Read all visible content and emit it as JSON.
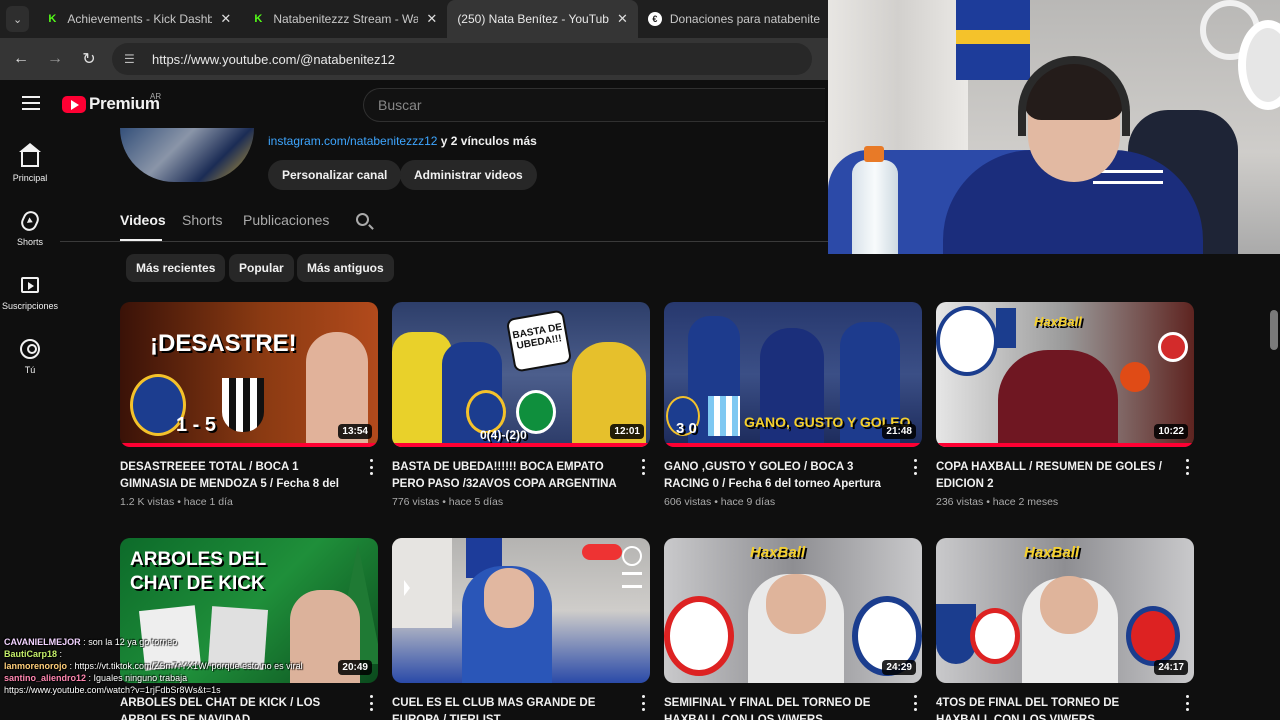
{
  "browser": {
    "tabs": [
      {
        "title": "Achievements - Kick Dashbo",
        "icon": "kick-icon",
        "active": false
      },
      {
        "title": "Natabenitezzz Stream - Wat",
        "icon": "kick-icon",
        "active": false
      },
      {
        "title": "(250) Nata Benítez - YouTub",
        "icon": "youtube-icon",
        "active": true
      },
      {
        "title": "Donaciones para natabenite",
        "icon": "donation-icon",
        "active": false
      }
    ],
    "url": "https://www.youtube.com/@natabenitez12"
  },
  "youtube": {
    "logo_word": "Premium",
    "country": "AR",
    "search_placeholder": "Buscar",
    "sidebar": [
      {
        "label": "Principal",
        "icon": "home-icon"
      },
      {
        "label": "Shorts",
        "icon": "shorts-icon"
      },
      {
        "label": "Suscripciones",
        "icon": "subscriptions-icon"
      },
      {
        "label": "Tú",
        "icon": "you-icon"
      }
    ],
    "channel": {
      "link": "instagram.com/natabenitezzz12",
      "more_links": "y 2 vínculos más",
      "customize_button": "Personalizar canal",
      "manage_button": "Administrar videos"
    },
    "tabs": [
      "Videos",
      "Shorts",
      "Publicaciones"
    ],
    "filters": [
      "Más recientes",
      "Popular",
      "Más antiguos"
    ],
    "videos": [
      {
        "title": "DESASTREEEE TOTAL / BOCA 1 GIMNASIA DE MENDOZA 5 / Fecha 8 del torneo...",
        "views": "1.2 K vistas",
        "age": "hace 1 día",
        "duration": "13:54",
        "thumb_text": "¡DESASTRE!",
        "thumb_score": "1 - 5"
      },
      {
        "title": "BASTA DE UBEDA!!!!!! BOCA EMPATO PERO PASO /32AVOS COPA ARGENTINA",
        "views": "776 vistas",
        "age": "hace 5 días",
        "duration": "12:01",
        "thumb_text": "BASTA DE UBEDA!!!",
        "thumb_score": "0(4)-(2)0"
      },
      {
        "title": "GANO ,GUSTO Y GOLEO / BOCA 3 RACING 0 / Fecha 6 del torneo Apertura 2026",
        "views": "606 vistas",
        "age": "hace 9 días",
        "duration": "21:48",
        "thumb_text": "GANO, GUSTO Y GOLEO",
        "thumb_score": "3 0"
      },
      {
        "title": "COPA HAXBALL / RESUMEN DE GOLES / EDICION 2",
        "views": "236 vistas",
        "age": "hace 2 meses",
        "duration": "10:22",
        "thumb_text": "HaxBall",
        "thumb_score": ""
      },
      {
        "title": "ARBOLES DEL CHAT DE KICK / LOS ARBOLES DE NAVIDAD",
        "views": "",
        "age": "",
        "duration": "20:49",
        "thumb_text": "ARBOLES DEL CHAT DE KICK",
        "thumb_score": ""
      },
      {
        "title": "CUEL ES EL CLUB MAS GRANDE DE EUROPA / TIERLIST",
        "views": "",
        "age": "",
        "duration": "",
        "thumb_text": "",
        "thumb_score": ""
      },
      {
        "title": "SEMIFINAL Y FINAL DEL TORNEO DE HAXBALL CON LOS VIWERS",
        "views": "",
        "age": "",
        "duration": "24:29",
        "thumb_text": "HaxBall",
        "thumb_score": ""
      },
      {
        "title": "4TOS DE FINAL DEL TORNEO DE HAXBALL CON LOS VIWERS",
        "views": "",
        "age": "",
        "duration": "24:17",
        "thumb_text": "HaxBall",
        "thumb_score": ""
      }
    ]
  },
  "chat": [
    {
      "user": "CAVANIELMEJOR",
      "message": "son la 12 ya go torneo",
      "color": "#f2d3ff"
    },
    {
      "user": "BautiCarp18",
      "message": "",
      "color": "#c5f06a"
    },
    {
      "user": "lanmorenorojo",
      "message": "https://vt.tiktok.com/ZSm7rYX1W/ porque esto no es viral",
      "color": "#ffcf7a"
    },
    {
      "user": "santino_aliendro12",
      "message": "Iguales ninguno trabaja",
      "color": "#ff86b0"
    },
    {
      "user": "",
      "message": "https://www.youtube.com/watch?v=1rjFdbSr8Ws&t=1s",
      "color": "#ffffff"
    }
  ]
}
